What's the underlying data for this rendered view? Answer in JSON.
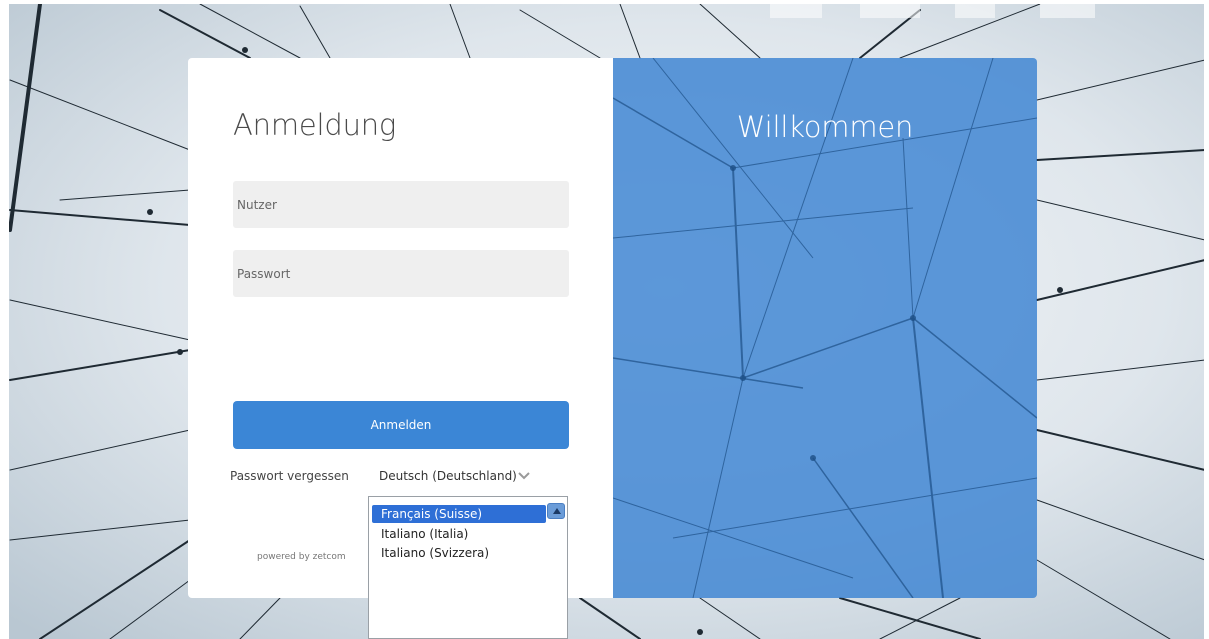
{
  "login": {
    "title": "Anmeldung",
    "username_placeholder": "Nutzer",
    "password_placeholder": "Passwort",
    "submit_label": "Anmelden",
    "forgot_password_label": "Passwort vergessen",
    "language_selected": "Deutsch (Deutschland)",
    "powered_by": "powered by zetcom"
  },
  "welcome": {
    "title": "Willkommen"
  },
  "language_dropdown": {
    "options": [
      "Français (Suisse)",
      "Italiano (Italia)",
      "Italiano (Svizzera)"
    ],
    "selected_index": 0
  },
  "icons": {
    "chevron": "chevron-down-icon",
    "scroll_up": "scroll-up-arrow-icon"
  },
  "colors": {
    "accent": "#3b86d6",
    "welcome_panel": "#3a82d2",
    "field_background": "#efefef"
  }
}
